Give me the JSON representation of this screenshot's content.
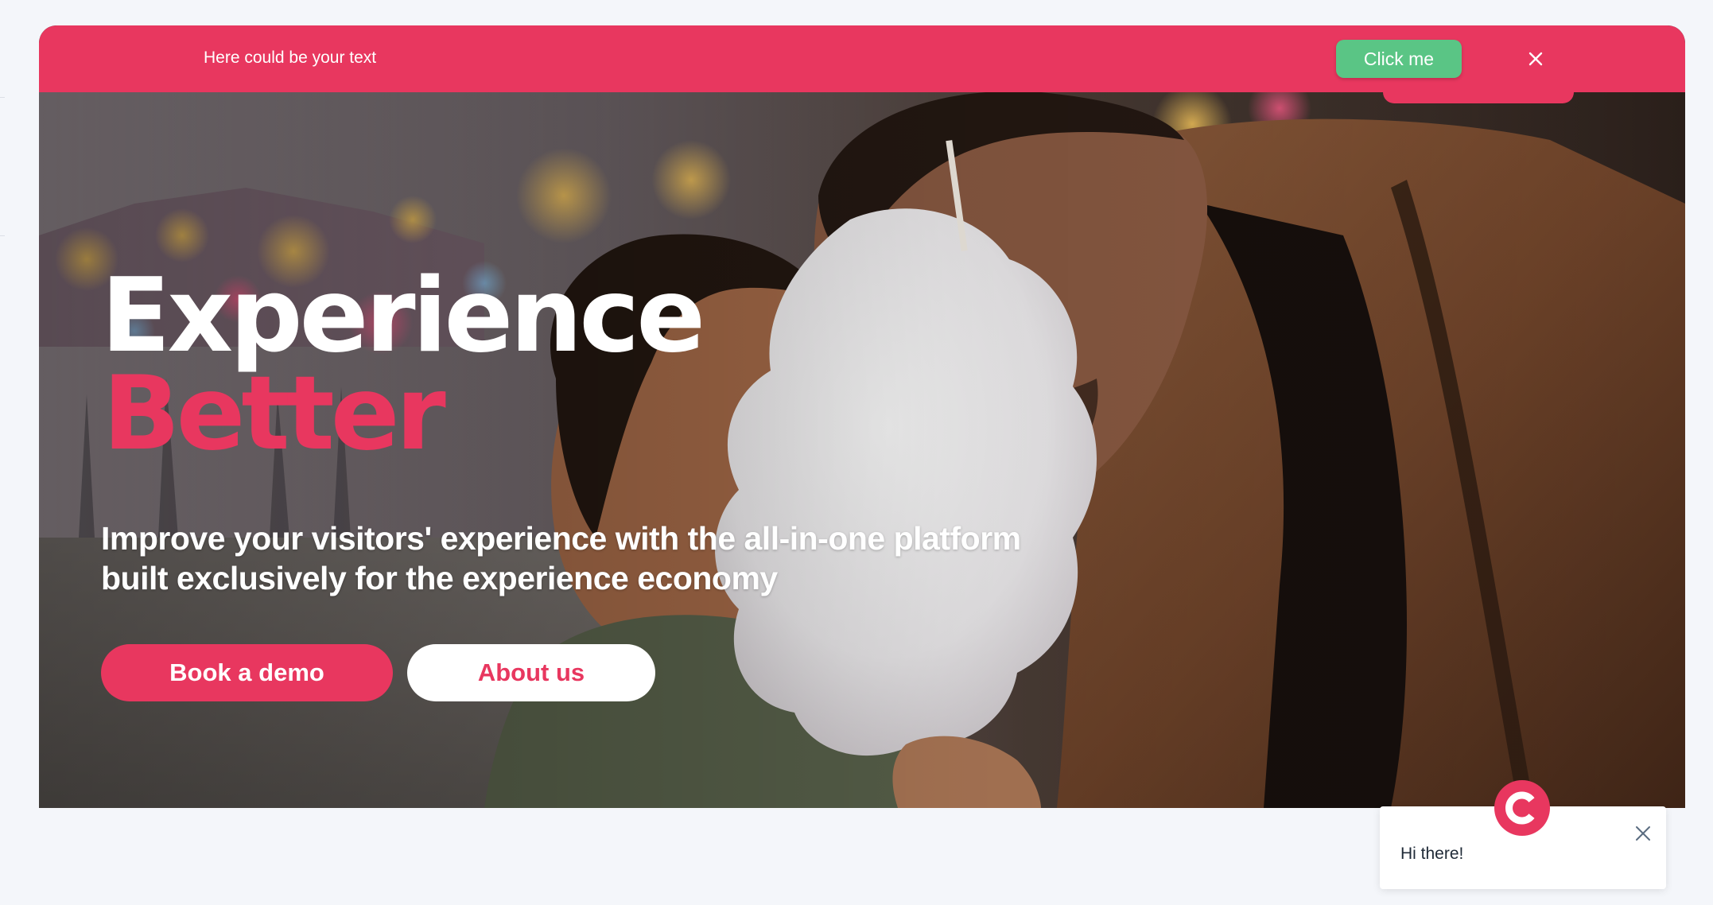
{
  "notice": {
    "text": "Here could be your text",
    "cta_label": "Click me",
    "close_icon": "close-icon",
    "background": "#e8375f",
    "cta_color": "#5ac585"
  },
  "hero": {
    "title_line1": "Experience",
    "title_line2": "Better",
    "subtitle_line1": "Improve your visitors' experience with the all-in-one platform",
    "subtitle_line2": "built exclusively for the experience economy",
    "primary_button": "Book a demo",
    "secondary_button": "About us",
    "accent_color": "#e8375f",
    "image": "photo-father-and-child-eating-cotton-candy-at-fair"
  },
  "chat": {
    "message": "Hi there!",
    "avatar_letter": "C",
    "close_icon": "close-icon",
    "avatar_color": "#e8375f"
  }
}
